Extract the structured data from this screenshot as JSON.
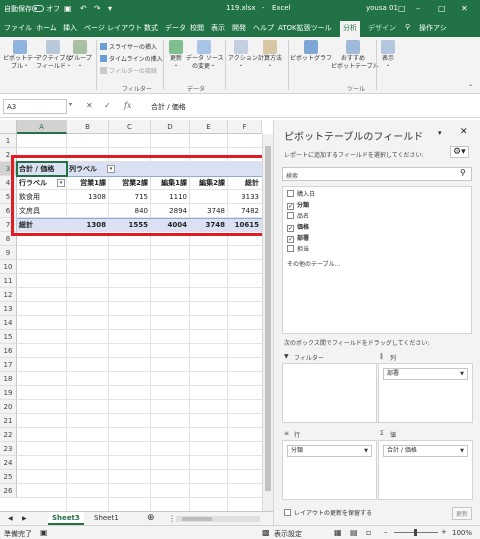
{
  "title_bar": {
    "autosave_label": "自動保存",
    "autosave_state": "オフ",
    "file_name": "119.xlsx",
    "app_name": "Excel",
    "user": "yousa 01"
  },
  "ribbon": {
    "tabs": [
      "ファイル",
      "ホーム",
      "挿入",
      "ページ レイアウト",
      "数式",
      "データ",
      "校閲",
      "表示",
      "開発",
      "ヘルプ",
      "ATOK拡張ツール",
      "分析",
      "デザイン"
    ],
    "active_tab": "分析",
    "tell_me": "操作アシ",
    "buttons": {
      "pivot_table": "ピボットテー\nブル・",
      "active_field": "アクティブな\nフィールド・",
      "group": "グループ\n・",
      "insert_slicer": "スライサーの挿入",
      "insert_timeline": "タイムラインの挿入",
      "filter_connections": "フィルターの接続",
      "refresh": "更新\n・",
      "change_source": "データ ソース\nの変更・",
      "action": "アクション\n・",
      "calculation": "計算方法\n・",
      "pivot_chart": "ピボットグラフ",
      "recommended": "おすすめ\nピボットテーブル",
      "show": "表示\n・"
    },
    "groups": {
      "filter": "フィルター",
      "data": "データ",
      "tools": "ツール"
    }
  },
  "formula_bar": {
    "name_box": "A3",
    "fx": "fx",
    "content": "合計 / 価格"
  },
  "grid": {
    "columns": [
      "A",
      "B",
      "C",
      "D",
      "E",
      "F"
    ],
    "rows": [
      "1",
      "2",
      "3",
      "4",
      "5",
      "6",
      "7",
      "8",
      "9",
      "10",
      "11",
      "12",
      "13",
      "14",
      "15",
      "16",
      "17",
      "18",
      "19",
      "20",
      "21",
      "22",
      "23",
      "24",
      "25",
      "26"
    ],
    "selected_cell": "A3"
  },
  "pivot": {
    "value_header": "合計 / 価格",
    "col_label": "列ラベル",
    "row_label": "行ラベル",
    "col_headers": [
      "営業1課",
      "営業2課",
      "編集1課",
      "編集2課",
      "総計"
    ],
    "rows": [
      {
        "label": "飲食用",
        "values": [
          "1308",
          "715",
          "1110",
          "",
          "3133"
        ]
      },
      {
        "label": "文房具",
        "values": [
          "",
          "840",
          "2894",
          "3748",
          "7482"
        ]
      }
    ],
    "total": {
      "label": "総計",
      "values": [
        "1308",
        "1555",
        "4004",
        "3748",
        "10615"
      ]
    }
  },
  "sheets": {
    "tabs": [
      "Sheet3",
      "Sheet1"
    ],
    "active": "Sheet3"
  },
  "status": {
    "ready": "準備完了",
    "display_settings": "表示設定",
    "zoom": "100%"
  },
  "field_pane": {
    "title": "ピボットテーブルのフィールド",
    "subtitle": "レポートに追加するフィールドを選択してください:",
    "search_placeholder": "検索",
    "fields": [
      {
        "name": "購入日",
        "checked": false
      },
      {
        "name": "分類",
        "checked": true
      },
      {
        "name": "品名",
        "checked": false
      },
      {
        "name": "価格",
        "checked": true
      },
      {
        "name": "部署",
        "checked": true
      },
      {
        "name": "担当",
        "checked": false
      }
    ],
    "more_tables": "その他のテーブル...",
    "drag_hint": "次のボックス間でフィールドをドラッグしてください:",
    "areas": {
      "filter": {
        "label": "フィルター",
        "items": []
      },
      "columns": {
        "label": "列",
        "items": [
          "部署"
        ]
      },
      "rows": {
        "label": "行",
        "items": [
          "分類"
        ]
      },
      "values": {
        "label": "値",
        "items": [
          "合計 / 価格"
        ]
      }
    },
    "defer_label": "レイアウトの更新を保留する",
    "update_label": "更新"
  }
}
